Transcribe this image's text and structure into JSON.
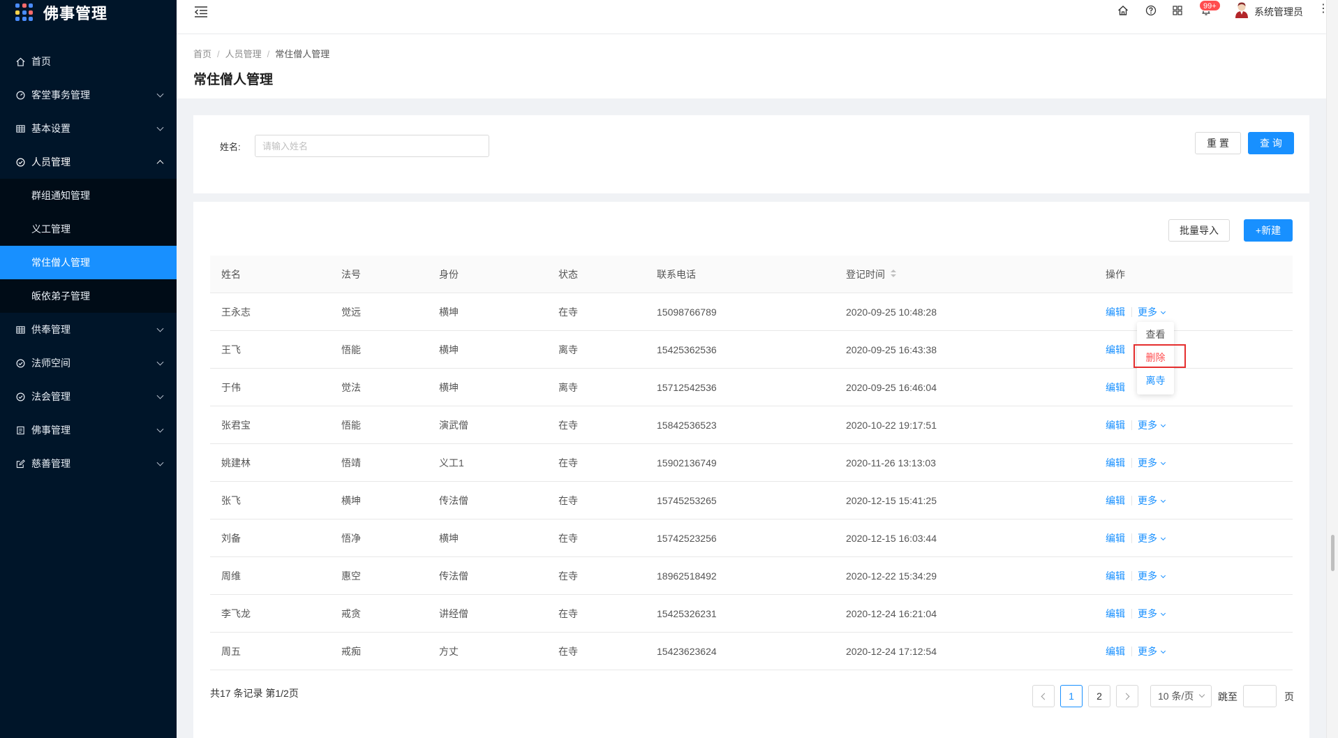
{
  "app": {
    "title": "佛事管理"
  },
  "sidebar": {
    "items": [
      {
        "label": "首页",
        "icon": "home-icon"
      },
      {
        "label": "客堂事务管理",
        "icon": "dashboard-icon"
      },
      {
        "label": "基本设置",
        "icon": "table-icon"
      },
      {
        "label": "人员管理",
        "icon": "check-circle-icon"
      },
      {
        "label": "供奉管理",
        "icon": "table-icon"
      },
      {
        "label": "法师空间",
        "icon": "check-circle-icon"
      },
      {
        "label": "法会管理",
        "icon": "check-circle-icon"
      },
      {
        "label": "佛事管理",
        "icon": "profile-icon"
      },
      {
        "label": "慈善管理",
        "icon": "form-icon"
      }
    ],
    "submenu": [
      {
        "label": "群组通知管理"
      },
      {
        "label": "义工管理"
      },
      {
        "label": "常住僧人管理"
      },
      {
        "label": "皈依弟子管理"
      }
    ]
  },
  "header": {
    "badge": "99+",
    "username": "系统管理员"
  },
  "breadcrumb": [
    "首页",
    "人员管理",
    "常住僧人管理"
  ],
  "page_title": "常住僧人管理",
  "search": {
    "label": "姓名:",
    "value": "",
    "placeholder": "请输入姓名",
    "reset_label": "重 置",
    "query_label": "查 询"
  },
  "toolbar": {
    "import_label": "批量导入",
    "new_label": "+新建"
  },
  "table": {
    "columns": [
      "姓名",
      "法号",
      "身份",
      "状态",
      "联系电话",
      "登记时间",
      "操作"
    ],
    "edit_label": "编辑",
    "more_label": "更多",
    "rows": [
      [
        "王永志",
        "觉远",
        "横坤",
        "在寺",
        "15098766789",
        "2020-09-25 10:48:28"
      ],
      [
        "王飞",
        "悟能",
        "横坤",
        "离寺",
        "15425362536",
        "2020-09-25 16:43:38"
      ],
      [
        "于伟",
        "觉法",
        "横坤",
        "离寺",
        "15712542536",
        "2020-09-25 16:46:04"
      ],
      [
        "张君宝",
        "悟能",
        "演武僧",
        "在寺",
        "15842536523",
        "2020-10-22 19:17:51"
      ],
      [
        "姚建林",
        "悟靖",
        "义工1",
        "在寺",
        "15902136749",
        "2020-11-26 13:13:03"
      ],
      [
        "张飞",
        "横坤",
        "传法僧",
        "在寺",
        "15745253265",
        "2020-12-15 15:41:25"
      ],
      [
        "刘备",
        "悟净",
        "横坤",
        "在寺",
        "15742523256",
        "2020-12-15 16:03:44"
      ],
      [
        "周维",
        "惠空",
        "传法僧",
        "在寺",
        "18962518492",
        "2020-12-22 15:34:29"
      ],
      [
        "李飞龙",
        "戒贪",
        "讲经僧",
        "在寺",
        "15425326231",
        "2020-12-24 16:21:04"
      ],
      [
        "周五",
        "戒痴",
        "方丈",
        "在寺",
        "15423623624",
        "2020-12-24 17:12:54"
      ]
    ]
  },
  "dropdown": {
    "items": [
      {
        "label": "查看",
        "color": "#555555"
      },
      {
        "label": "删除",
        "color": "#ff4d4f"
      },
      {
        "label": "离寺",
        "color": "#1890ff"
      }
    ]
  },
  "pagination": {
    "total_text": "共17 条记录 第1/2页",
    "pages": [
      "1",
      "2"
    ],
    "current_page": "1",
    "page_size": "10 条/页",
    "jump_label": "跳至",
    "page_suffix": "页",
    "jump_value": ""
  },
  "colors": {
    "sidebar_bg": "#001529",
    "primary": "#1890ff",
    "danger": "#ff4d4f"
  }
}
